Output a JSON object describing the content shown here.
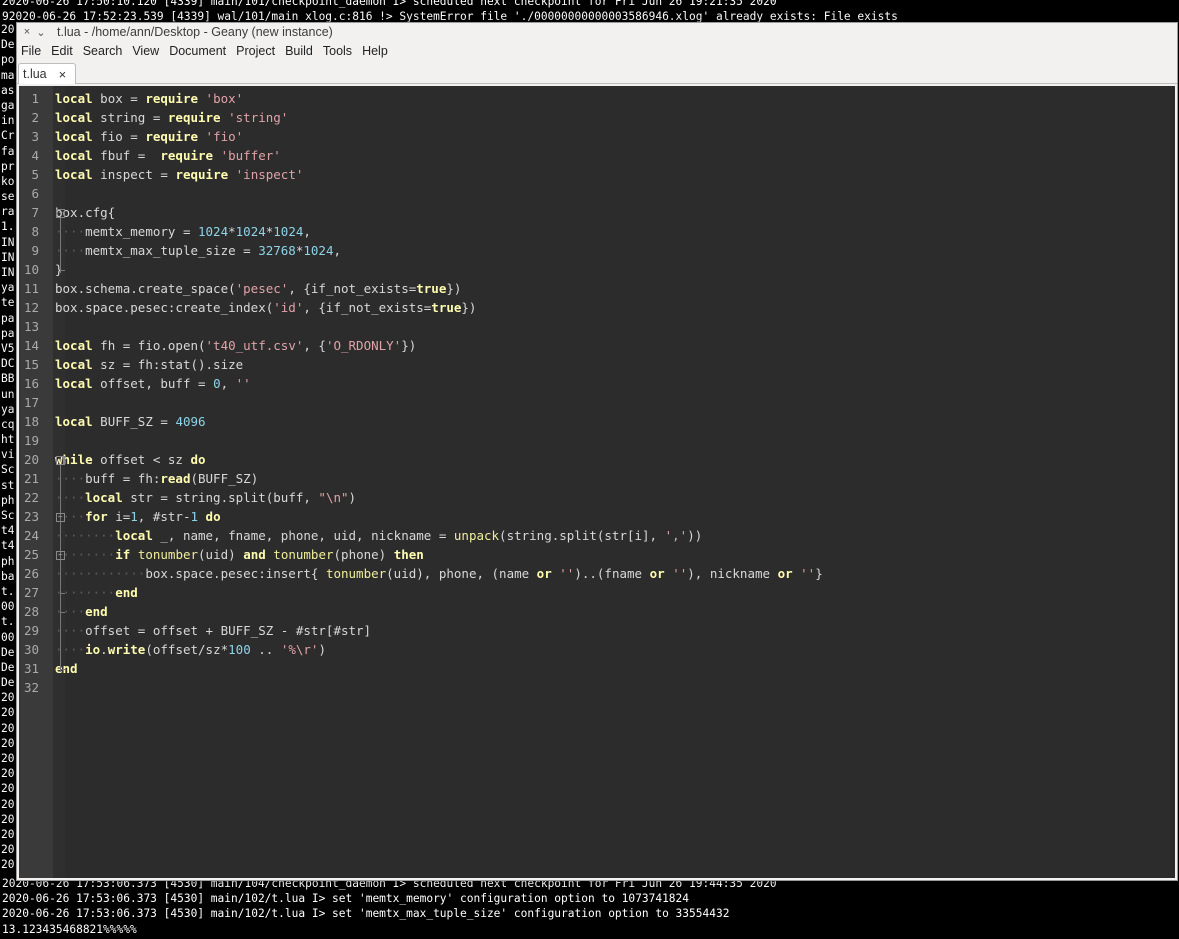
{
  "terminal": {
    "top_lines": [
      "2020-06-26 17:50:10.120 [4339] main/101/checkpoint_daemon I> scheduled next checkpoint for Fri Jun 26 19:21:35 2020",
      "92020-06-26 17:52:23.539 [4339] wal/101/main xlog.c:816 !> SystemError file './00000000000003586946.xlog' already exists: File exists"
    ],
    "left_fragments": [
      "20",
      "De",
      "po",
      "ma",
      "as",
      "ga",
      "in",
      "Cr",
      "fa",
      "pr",
      "ko",
      "se",
      "ra",
      "1.",
      "IN",
      "IN",
      "IN",
      "ya",
      "te",
      "pa",
      "pa",
      "V5",
      "DC",
      "BB",
      "un",
      "ya",
      "cq",
      "ht",
      "vi",
      "Sc",
      "st",
      "ph",
      "Sc",
      "t4",
      "t4",
      "ph",
      "ba",
      "t.",
      "00",
      "t.",
      "00",
      "De",
      "De",
      "De",
      "20",
      "20",
      "20",
      "20",
      "20",
      "20",
      "20",
      "20",
      "20",
      "20",
      "20",
      "20"
    ],
    "bottom_lines": [
      "2020-06-26 17:53:06.373 [4530] main/104/checkpoint_daemon I> scheduled next checkpoint for Fri Jun 26 19:44:35 2020",
      "2020-06-26 17:53:06.373 [4530] main/102/t.lua I> set 'memtx_memory' configuration option to 1073741824",
      "2020-06-26 17:53:06.373 [4530] main/102/t.lua I> set 'memtx_max_tuple_size' configuration option to 33554432",
      "13.123435468821%%%%%"
    ]
  },
  "window": {
    "title": "t.lua - /home/ann/Desktop - Geany (new instance)",
    "close_glyph": "×",
    "chevron_glyph": "⌄"
  },
  "menu": [
    "File",
    "Edit",
    "Search",
    "View",
    "Document",
    "Project",
    "Build",
    "Tools",
    "Help"
  ],
  "tab": {
    "label": "t.lua",
    "close": "×"
  },
  "code_lines": [
    "local box = require 'box'",
    "local string = require 'string'",
    "local fio = require 'fio'",
    "local fbuf =  require 'buffer'",
    "local inspect = require 'inspect'",
    "",
    "box.cfg{",
    "    memtx_memory = 1024*1024*1024,",
    "    memtx_max_tuple_size = 32768*1024,",
    "}",
    "box.schema.create_space('pesec', {if_not_exists=true})",
    "box.space.pesec:create_index('id', {if_not_exists=true})",
    "",
    "local fh = fio.open('t40_utf.csv', {'O_RDONLY'})",
    "local sz = fh:stat().size",
    "local offset, buff = 0, ''",
    "",
    "local BUFF_SZ = 4096",
    "",
    "while offset < sz do",
    "    buff = fh:read(BUFF_SZ)",
    "    local str = string.split(buff, \"\\n\")",
    "    for i=1, #str-1 do",
    "        local _, name, fname, phone, uid, nickname = unpack(string.split(str[i], ','))",
    "        if tonumber(uid) and tonumber(phone) then",
    "            box.space.pesec:insert{ tonumber(uid), phone, (name or '')..(fname or ''), nickname or ''}",
    "        end",
    "    end",
    "    offset = offset + BUFF_SZ - #str[#str]",
    "    io.write(offset/sz*100 .. '%\\r')",
    "end",
    ""
  ],
  "line_numbers": [
    "1",
    "2",
    "3",
    "4",
    "5",
    "6",
    "7",
    "8",
    "9",
    "10",
    "11",
    "12",
    "13",
    "14",
    "15",
    "16",
    "17",
    "18",
    "19",
    "20",
    "21",
    "22",
    "23",
    "24",
    "25",
    "26",
    "27",
    "28",
    "29",
    "30",
    "31",
    "32"
  ],
  "fold_points": [
    7,
    20,
    23,
    25
  ],
  "colors": {
    "editor_bg": "#2c2c2c",
    "keyword": "#fffcb0",
    "string": "#e0a3a8",
    "number": "#8fd3e8",
    "text": "#d8d8d8"
  }
}
